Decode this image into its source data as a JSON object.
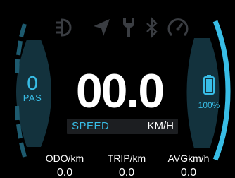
{
  "colors": {
    "accent": "#38bde6",
    "icon_dim": "#3a3d42",
    "bar_bg": "#1c1e21",
    "arc_dim": "#13323d"
  },
  "status_icons": [
    "headlight-icon",
    "navigation-icon",
    "wrench-icon",
    "bluetooth-icon",
    "speedometer-icon"
  ],
  "pas": {
    "level": "0",
    "label": "PAS"
  },
  "speed": {
    "value": "00.0",
    "label": "SPEED",
    "unit": "KM/H"
  },
  "battery": {
    "level_fraction": 1.0,
    "percent": "100%"
  },
  "stats": [
    {
      "name": "ODO",
      "unit": "/km",
      "value": "0.0"
    },
    {
      "name": "TRIP",
      "unit": "/km",
      "value": "0.0"
    },
    {
      "name": "AVG",
      "unit": "km/h",
      "value": "0.0"
    }
  ]
}
